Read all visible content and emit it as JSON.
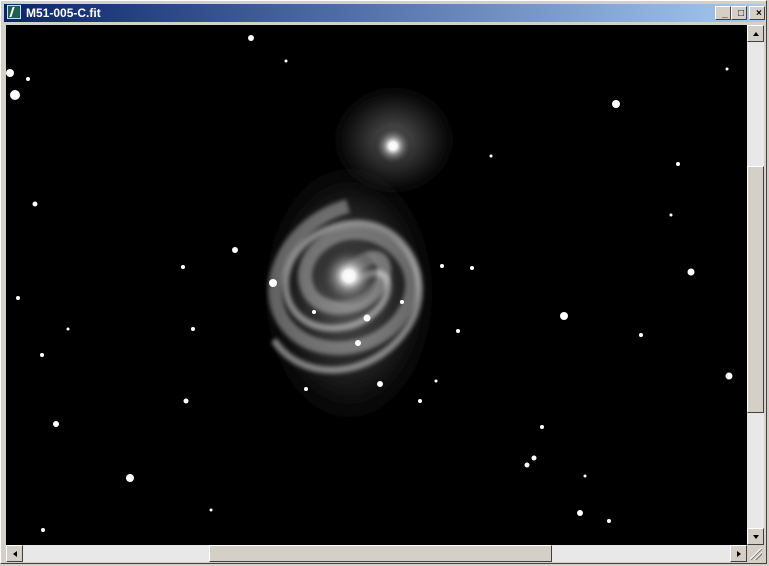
{
  "window": {
    "title": "M51-005-C.fit",
    "icon": "fits-image-icon",
    "controls": {
      "minimize": "_",
      "maximize": "□",
      "close": "×"
    }
  },
  "image_view": {
    "subject": "spiral galaxy",
    "background_color": "#000000"
  },
  "scrollbars": {
    "vertical_position": 0.45,
    "horizontal_position": 0.45
  }
}
